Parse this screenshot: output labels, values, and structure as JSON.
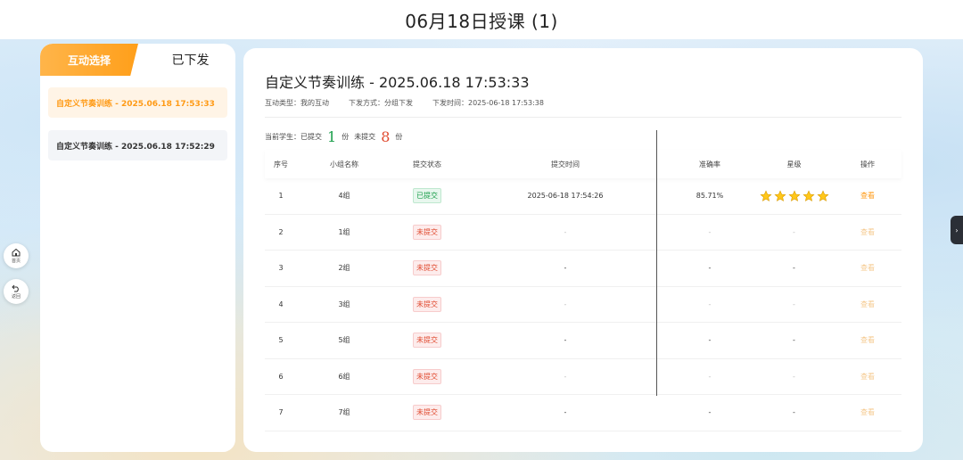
{
  "header": {
    "title": "06月18日授课 (1)"
  },
  "left_panel": {
    "tabs": [
      {
        "label": "互动选择",
        "active": false
      },
      {
        "label": "已下发",
        "active": true
      }
    ],
    "items": [
      {
        "label": "自定义节奏训练 - 2025.06.18 17:53:33",
        "active": true
      },
      {
        "label": "自定义节奏训练 - 2025.06.18 17:52:29",
        "active": false
      }
    ]
  },
  "side_buttons": {
    "home": "首页",
    "back": "返回"
  },
  "main": {
    "title": "自定义节奏训练 - 2025.06.18 17:53:33",
    "meta": {
      "type": "互动类型：我的互动",
      "method": "下发方式：分组下发",
      "time": "下发时间：2025-06-18 17:53:38"
    },
    "counts": {
      "prefix": "当前学生：",
      "submitted_label": "已提交",
      "submitted": "1",
      "unit": "份",
      "pending_label": "未提交",
      "pending": "8"
    },
    "table": {
      "headers": [
        "序号",
        "小组名称",
        "提交状态",
        "提交时间",
        "准确率",
        "星级",
        "操作"
      ],
      "rows": [
        {
          "index": "1",
          "group": "4组",
          "status": "已提交",
          "time": "2025-06-18 17:54:26",
          "accuracy": "85.71%",
          "stars": 5,
          "action": "查看"
        },
        {
          "index": "2",
          "group": "1组",
          "status": "未提交",
          "time": "-",
          "accuracy": "-",
          "stars": 0,
          "star_text": "-",
          "action": "查看"
        },
        {
          "index": "3",
          "group": "2组",
          "status": "未提交",
          "time": "-",
          "accuracy": "-",
          "stars": 0,
          "star_text": "-",
          "action": "查看"
        },
        {
          "index": "4",
          "group": "3组",
          "status": "未提交",
          "time": "-",
          "accuracy": "-",
          "stars": 0,
          "star_text": "-",
          "action": "查看"
        },
        {
          "index": "5",
          "group": "5组",
          "status": "未提交",
          "time": "-",
          "accuracy": "-",
          "stars": 0,
          "star_text": "-",
          "action": "查看"
        },
        {
          "index": "6",
          "group": "6组",
          "status": "未提交",
          "time": "-",
          "accuracy": "-",
          "stars": 0,
          "star_text": "-",
          "action": "查看"
        },
        {
          "index": "7",
          "group": "7组",
          "status": "未提交",
          "time": "-",
          "accuracy": "-",
          "stars": 0,
          "star_text": "-",
          "action": "查看"
        }
      ]
    }
  },
  "colors": {
    "accent": "#ff9a15",
    "success": "#1a9e4a",
    "danger": "#e04a2f"
  }
}
